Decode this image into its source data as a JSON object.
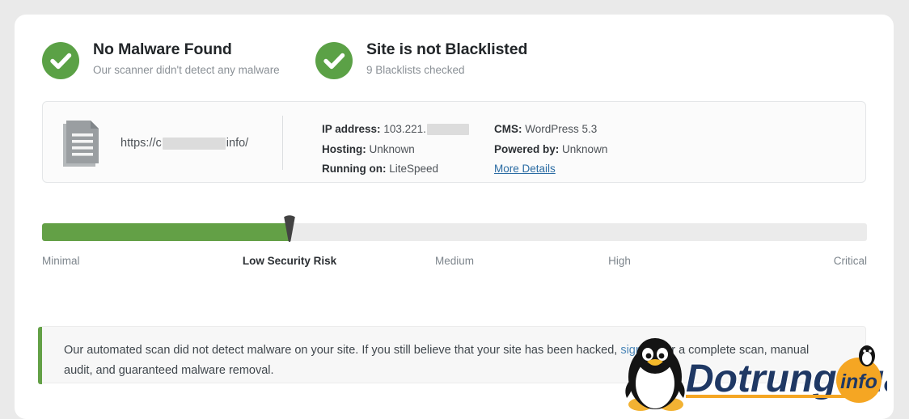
{
  "statuses": [
    {
      "icon": "check-circle-icon",
      "title": "No Malware Found",
      "subtitle": "Our scanner didn't detect any malware"
    },
    {
      "icon": "check-circle-icon",
      "title": "Site is not Blacklisted",
      "subtitle": "9 Blacklists checked"
    }
  ],
  "site_info": {
    "icon": "document-icon",
    "url_prefix": "https://c",
    "url_suffix": "info/",
    "details": {
      "ip_label": "IP address:",
      "ip_value": "103.221.",
      "hosting_label": "Hosting:",
      "hosting_value": "Unknown",
      "running_label": "Running on:",
      "running_value": "LiteSpeed",
      "cms_label": "CMS:",
      "cms_value": "WordPress 5.3",
      "powered_label": "Powered by:",
      "powered_value": "Unknown",
      "more_details_link": "More Details"
    }
  },
  "risk_meter": {
    "fill_percent": 30,
    "marker_percent": 30,
    "fill_color": "#63a046",
    "track_color": "#ebebeb",
    "scale": [
      {
        "label": "Minimal",
        "position": 0,
        "current": false
      },
      {
        "label": "Low Security Risk",
        "position": 30,
        "current": true
      },
      {
        "label": "Medium",
        "position": 50,
        "current": false
      },
      {
        "label": "High",
        "position": 70,
        "current": false
      },
      {
        "label": "Critical",
        "position": 100,
        "current": false
      }
    ]
  },
  "notice": {
    "accent_color": "#63a046",
    "text_before": "Our automated scan did not detect malware on your site. If you still believe that your site has been hacked, ",
    "link_text": "sign up",
    "text_after": " for a complete scan, manual audit, and guaranteed malware removal."
  },
  "watermark": {
    "icon": "penguin-icon",
    "brand": "Dotrungquan",
    "badge": "info",
    "brand_color": "#1f3864",
    "badge_color": "#f5a623"
  }
}
